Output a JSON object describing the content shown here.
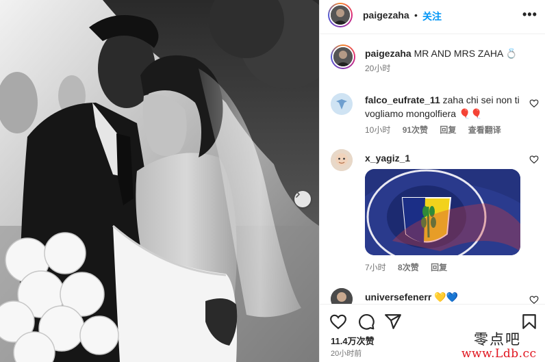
{
  "post": {
    "username": "paigezaha",
    "dot": "•",
    "follow_label": "关注",
    "more_icon": "more-horizontal-icon"
  },
  "caption": {
    "username": "paigezaha",
    "text": "MR AND MRS ZAHA 💍",
    "time": "20小时"
  },
  "comments": [
    {
      "username": "falco_eufrate_11",
      "text": "zaha chi sei non ti vogliamo mongolfiera 🎈🎈",
      "time": "10小时",
      "likes": "91次赞",
      "reply": "回复",
      "translate": "查看翻译"
    },
    {
      "username": "x_yagiz_1",
      "text": "",
      "gif_text": "FENERBAHÇE SPOR KLÜBÜ",
      "time": "7小时",
      "likes": "8次赞",
      "reply": "回复"
    },
    {
      "username": "universefenerr",
      "text": "💛💙"
    }
  ],
  "footer": {
    "likes": "11.4万次赞",
    "time": "20小时前"
  },
  "watermark": {
    "line1": "零点吧",
    "line2": "www.Ldb.cc"
  },
  "colors": {
    "accent": "#0095f6",
    "text": "#262626",
    "muted": "#737373",
    "divider": "#efefef",
    "watermark_red": "#e0141e"
  }
}
